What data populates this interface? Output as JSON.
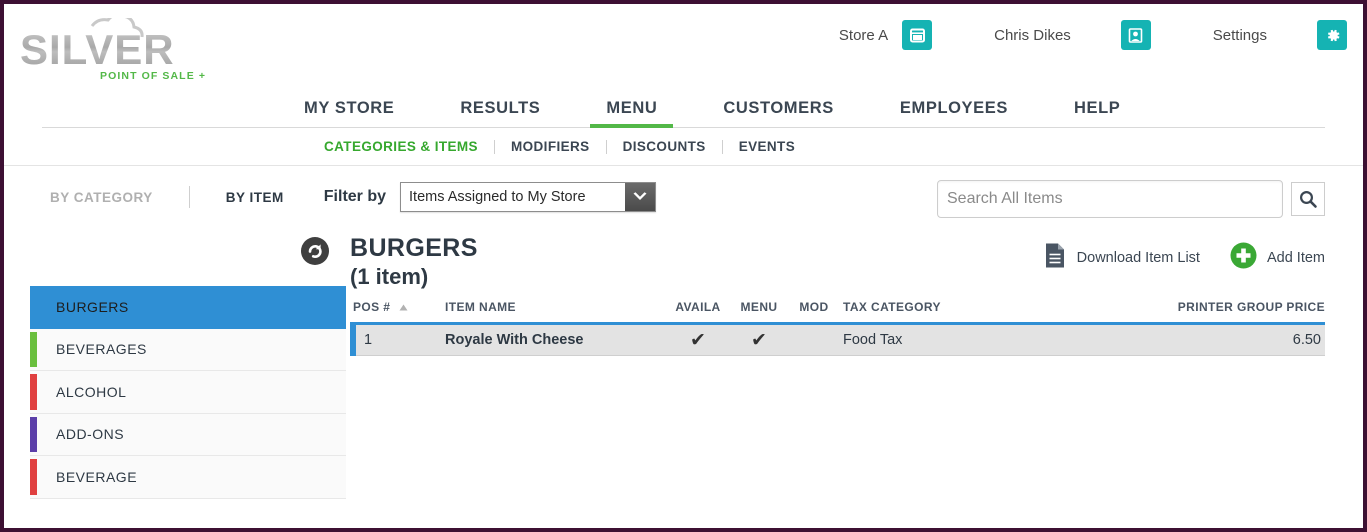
{
  "brand": {
    "name": "SILVER",
    "tagline": "POINT OF SALE +",
    "accent_green": "#53b848",
    "teal": "#15b3b3",
    "border_color": "#3d1033"
  },
  "header": {
    "store_label": "Store A",
    "store_icon": "store-icon",
    "user_label": "Chris Dikes",
    "user_icon": "user-icon",
    "settings_label": "Settings",
    "settings_icon": "gear-icon"
  },
  "mainnav": {
    "items": [
      {
        "label": "MY STORE",
        "active": false
      },
      {
        "label": "RESULTS",
        "active": false
      },
      {
        "label": "MENU",
        "active": true
      },
      {
        "label": "CUSTOMERS",
        "active": false
      },
      {
        "label": "EMPLOYEES",
        "active": false
      },
      {
        "label": "HELP",
        "active": false
      }
    ]
  },
  "subnav": {
    "items": [
      {
        "label": "CATEGORIES & ITEMS",
        "active": true
      },
      {
        "label": "MODIFIERS",
        "active": false
      },
      {
        "label": "DISCOUNTS",
        "active": false
      },
      {
        "label": "EVENTS",
        "active": false
      }
    ]
  },
  "filterbar": {
    "by_category_label": "BY CATEGORY",
    "by_item_label": "BY ITEM",
    "filter_by_label": "Filter by",
    "filter_select_value": "Items Assigned to My Store",
    "search_placeholder": "Search All Items",
    "search_value": "",
    "search_icon": "search-icon",
    "dropdown_icon": "chevron-down-icon"
  },
  "sidebar": {
    "categories": [
      {
        "label": "BURGERS",
        "color": "#2f8fd4",
        "selected": true
      },
      {
        "label": "BEVERAGES",
        "color": "#6abf3e",
        "selected": false
      },
      {
        "label": "ALCOHOL",
        "color": "#e04040",
        "selected": false
      },
      {
        "label": "ADD-ONS",
        "color": "#5b3ea8",
        "selected": false
      },
      {
        "label": "BEVERAGE",
        "color": "#e04040",
        "selected": false
      }
    ]
  },
  "content": {
    "refresh_icon": "refresh-back-icon",
    "category_title": "BURGERS",
    "item_count_label": "(1 item)",
    "download_label": "Download Item List",
    "download_icon": "document-icon",
    "add_item_label": "Add Item",
    "add_item_icon": "plus-circle-icon",
    "table": {
      "columns": [
        {
          "label": "POS #",
          "align": "left",
          "sorted": true
        },
        {
          "label": "ITEM NAME",
          "align": "left",
          "sorted": false
        },
        {
          "label": "AVAILA",
          "align": "center",
          "sorted": false
        },
        {
          "label": "MENU",
          "align": "center",
          "sorted": false
        },
        {
          "label": "MOD",
          "align": "center",
          "sorted": false
        },
        {
          "label": "TAX CATEGORY",
          "align": "left",
          "sorted": false
        },
        {
          "label": "PRINTER GROUP",
          "align": "right",
          "sorted": false
        },
        {
          "label": "PRICE",
          "align": "right",
          "sorted": false
        }
      ],
      "rows": [
        {
          "pos": "1",
          "name": "Royale With Cheese",
          "available": "✔",
          "menu": "✔",
          "mod": "",
          "tax_category": "Food Tax",
          "printer_group": "",
          "price": "6.50"
        }
      ]
    }
  }
}
